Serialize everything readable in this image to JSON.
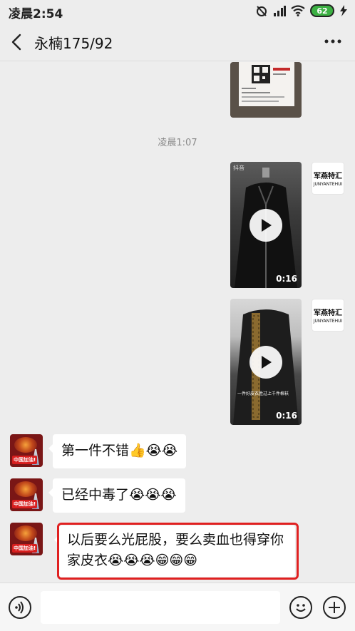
{
  "status_bar": {
    "time": "凌晨2:54",
    "battery": "62"
  },
  "header": {
    "title": "永楠175/92"
  },
  "chat": {
    "timestamp": "凌晨1:07",
    "videos": [
      {
        "duration": "0:16",
        "app_tag": "抖音",
        "caption": ""
      },
      {
        "duration": "0:16",
        "app_tag": "",
        "caption": "一件好皮衣胜过上千件棉袄"
      }
    ],
    "brand_avatar": {
      "cn": "军燕特汇",
      "en": "JUNYANTEHUI"
    },
    "user_avatar": {
      "label": "中国加油!"
    },
    "messages": [
      {
        "text": "第一件不错👍😭😭"
      },
      {
        "text": "已经中毒了😭😭😭"
      },
      {
        "line1": "以后要么光屁股，要么卖血也得穿你",
        "line2": "家皮衣😭😭😭😁😁😁"
      }
    ]
  },
  "input_bar": {
    "placeholder": ""
  },
  "colors": {
    "background": "#ededed",
    "bubble": "#ffffff",
    "highlight": "#e02020"
  }
}
